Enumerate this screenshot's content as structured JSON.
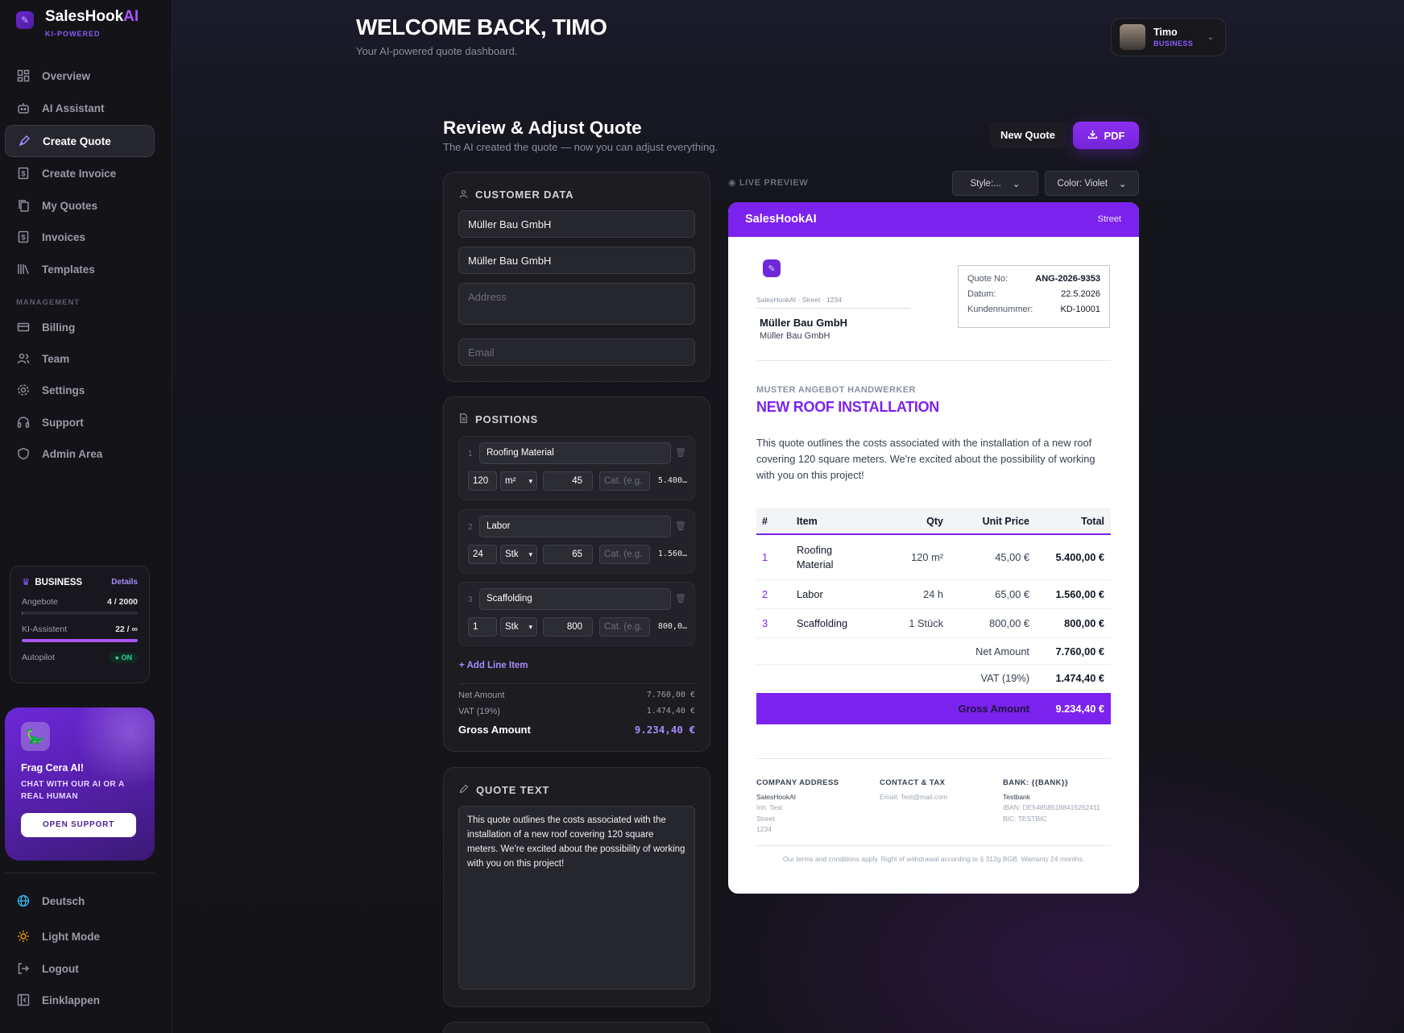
{
  "brand": {
    "name_main": "SalesHook",
    "name_ai": "AI",
    "tagline": "KI-POWERED"
  },
  "nav": {
    "items": [
      {
        "label": "Overview",
        "icon": "grid-icon"
      },
      {
        "label": "AI Assistant",
        "icon": "robot-icon"
      },
      {
        "label": "Create Quote",
        "icon": "pen-icon",
        "active": true
      },
      {
        "label": "Create Invoice",
        "icon": "dollar-file-icon"
      },
      {
        "label": "My Quotes",
        "icon": "copy-icon"
      },
      {
        "label": "Invoices",
        "icon": "dollar-file-icon"
      },
      {
        "label": "Templates",
        "icon": "library-icon"
      }
    ],
    "section_label": "MANAGEMENT",
    "management": [
      {
        "label": "Billing",
        "icon": "credit-card-icon"
      },
      {
        "label": "Team",
        "icon": "users-icon"
      },
      {
        "label": "Settings",
        "icon": "gear-icon"
      },
      {
        "label": "Support",
        "icon": "headset-icon"
      },
      {
        "label": "Admin Area",
        "icon": "shield-icon"
      }
    ],
    "bottom": [
      {
        "label": "Deutsch",
        "icon": "globe-icon"
      },
      {
        "label": "Light Mode",
        "icon": "sun-icon"
      },
      {
        "label": "Logout",
        "icon": "logout-icon"
      },
      {
        "label": "Einklappen",
        "icon": "collapse-icon"
      }
    ]
  },
  "plan": {
    "name": "BUSINESS",
    "details": "Details",
    "quotes_label": "Angebote",
    "quotes_value": "4 / 2000",
    "quotes_fraction": 0.002,
    "ai_label": "KI-Assistent",
    "ai_value": "22 / ∞",
    "ai_fraction": 1.0,
    "autopilot_label": "Autopilot",
    "autopilot_value": "ON"
  },
  "support": {
    "title": "Frag Cera AI!",
    "subtitle": "CHAT WITH OUR AI OR A REAL HUMAN",
    "button": "OPEN SUPPORT"
  },
  "header": {
    "welcome": "WELCOME BACK, TIMO",
    "subtitle": "Your AI-powered quote dashboard.",
    "user_name": "Timo",
    "user_plan": "BUSINESS"
  },
  "page": {
    "title": "Review & Adjust Quote",
    "subtitle": "The AI created the quote — now you can adjust everything.",
    "new_quote": "New Quote",
    "pdf": "PDF"
  },
  "customer": {
    "title": "CUSTOMER DATA",
    "company": "Müller Bau GmbH",
    "contact": "Müller Bau GmbH",
    "address_placeholder": "Address",
    "email_placeholder": "Email"
  },
  "positions": {
    "title": "POSITIONS",
    "items": [
      {
        "no": "1",
        "name": "Roofing Material",
        "qty": "120",
        "unit": "m²",
        "price": "45",
        "cat_placeholder": "Cat. (e.g.",
        "total": "5.400…"
      },
      {
        "no": "2",
        "name": "Labor",
        "qty": "24",
        "unit": "Stk",
        "price": "65",
        "cat_placeholder": "Cat. (e.g.",
        "total": "1.560…"
      },
      {
        "no": "3",
        "name": "Scaffolding",
        "qty": "1",
        "unit": "Stk",
        "price": "800",
        "cat_placeholder": "Cat. (e.g.",
        "total": "800,0…"
      }
    ],
    "add_line": "+ Add Line Item",
    "net_label": "Net Amount",
    "net_value": "7.760,00 €",
    "vat_label": "VAT (19%)",
    "vat_value": "1.474,40 €",
    "gross_label": "Gross Amount",
    "gross_value": "9.234,40 €"
  },
  "quote_text": {
    "title": "QUOTE TEXT",
    "body": "This quote outlines the costs associated with the installation of a new roof covering 120 square meters. We're excited about the possibility of working with you on this project!"
  },
  "preview": {
    "live_label": "LIVE PREVIEW",
    "style_dd": "Style:...",
    "color_dd": "Color: Violet",
    "band_title": "SalesHookAI",
    "band_right": "Street",
    "sender_line": "SalesHookAI · Street · 1234",
    "customer1": "Müller Bau GmbH",
    "customer2": "Müller Bau GmbH",
    "meta": [
      {
        "k": "Quote No:",
        "v": "ANG-2026-9353"
      },
      {
        "k": "Datum:",
        "v": "22.5.2026"
      },
      {
        "k": "Kundennummer:",
        "v": "KD-10001"
      }
    ],
    "kicker": "MUSTER ANGEBOT HANDWERKER",
    "heading": "NEW ROOF INSTALLATION",
    "intro": "This quote outlines the costs associated with the installation of a new roof covering 120 square meters. We're excited about the possibility of working with you on this project!",
    "table_head": {
      "no": "#",
      "item": "Item",
      "qty": "Qty",
      "unit_price": "Unit Price",
      "total": "Total"
    },
    "rows": [
      {
        "no": "1",
        "item": "Roofing Material",
        "qty": "120 m²",
        "unit_price": "45,00 €",
        "total": "5.400,00 €"
      },
      {
        "no": "2",
        "item": "Labor",
        "qty": "24 h",
        "unit_price": "65,00 €",
        "total": "1.560,00 €"
      },
      {
        "no": "3",
        "item": "Scaffolding",
        "qty": "1 Stück",
        "unit_price": "800,00 €",
        "total": "800,00 €"
      }
    ],
    "net_label": "Net Amount",
    "net_value": "7.760,00 €",
    "vat_label": "VAT (19%)",
    "vat_value": "1.474,40 €",
    "gross_label": "Gross Amount",
    "gross_value": "9.234,40 €",
    "footer": {
      "company_head": "COMPANY ADDRESS",
      "company_lines": [
        "SalesHookAI",
        "Inh. Test",
        "Street",
        "1234"
      ],
      "contact_head": "CONTACT & TAX",
      "contact_lines": [
        "Email: Test@mail.com"
      ],
      "bank_head": "BANK: {{BANK}}",
      "bank_lines": [
        "Testbank",
        "IBAN: DE54858518841526241​1",
        "BIC: TESTBIC"
      ]
    },
    "legal": "Our terms and conditions apply. Right of withdrawal according to § 312g BGB. Warranty 24 months."
  },
  "colors": {
    "accent": "#7c22ee",
    "accent_light": "#a78bfa",
    "bg": "#141419",
    "panel": "#1c1c21"
  }
}
